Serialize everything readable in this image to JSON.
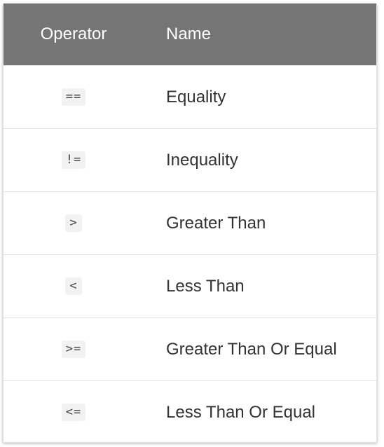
{
  "table": {
    "headers": {
      "operator": "Operator",
      "name": "Name"
    },
    "rows": [
      {
        "operator": "==",
        "name": "Equality"
      },
      {
        "operator": "!=",
        "name": "Inequality"
      },
      {
        "operator": ">",
        "name": "Greater Than"
      },
      {
        "operator": "<",
        "name": "Less Than"
      },
      {
        "operator": ">=",
        "name": "Greater Than Or Equal"
      },
      {
        "operator": "<=",
        "name": "Less Than Or Equal"
      }
    ],
    "colors": {
      "header_bg": "#757575",
      "header_text": "#ffffff",
      "body_text": "#333333",
      "code_bg": "#f2f2f2"
    }
  }
}
